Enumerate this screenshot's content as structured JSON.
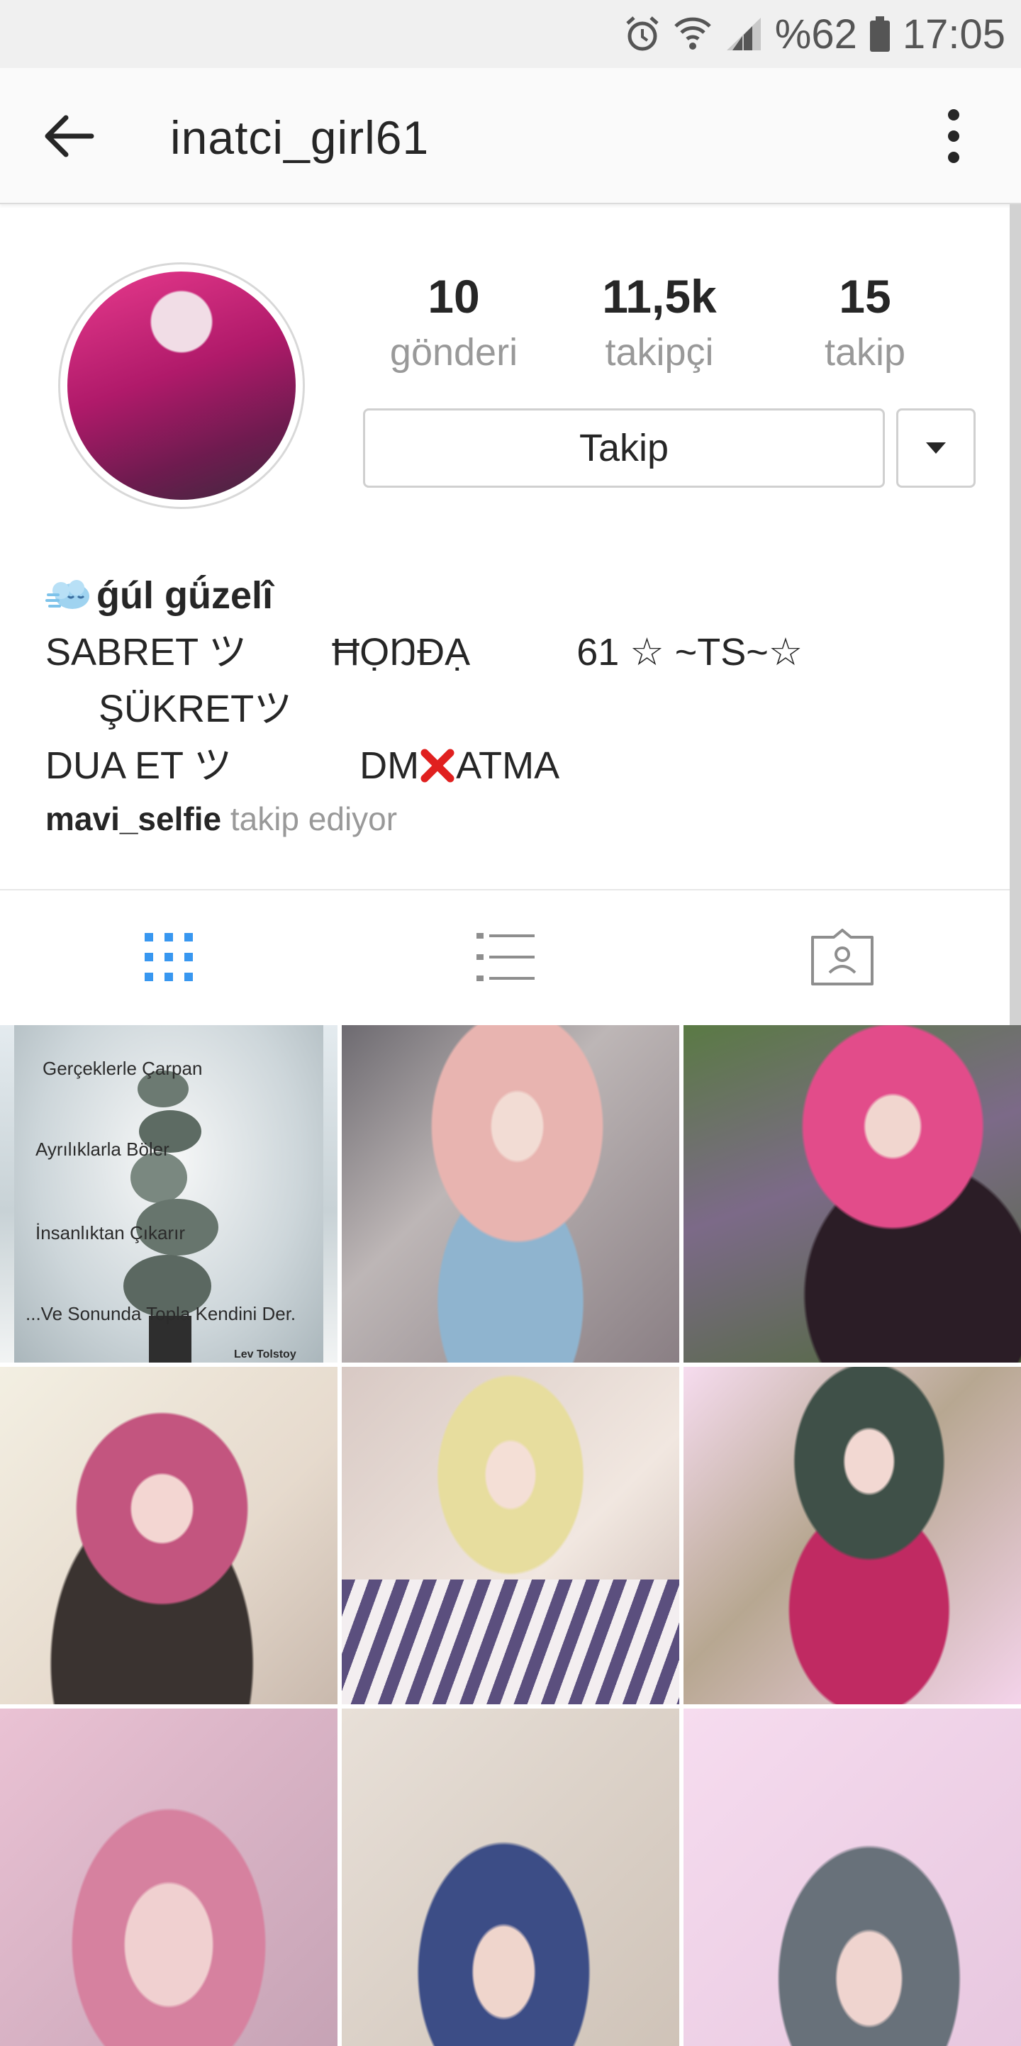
{
  "status_bar": {
    "battery": "%62",
    "time": "17:05",
    "icons": [
      "alarm-icon",
      "wifi-icon",
      "signal-icon",
      "battery-icon"
    ]
  },
  "app_bar": {
    "title": "inatci_girl61",
    "back_icon": "arrow-left-icon",
    "menu_icon": "more-vertical-icon"
  },
  "profile": {
    "posts_count": "10",
    "posts_label": "gönderi",
    "followers_count": "11,5k",
    "followers_label": "takipçi",
    "following_count": "15",
    "following_label": "takip",
    "follow_button": "Takip",
    "dropdown_icon": "caret-down-icon"
  },
  "bio": {
    "name": "ǵúl gǘzelî",
    "line1_a": "SABRET ツ",
    "line1_b": "ĦỌŊĐẠ",
    "line1_c": "61 ☆ ~TS~☆",
    "line2": "ŞÜKRETツ",
    "line3_a": "DUA ET ツ",
    "line3_b_pre": "DM",
    "line3_b_post": "ATMA",
    "followed_user": "mavi_selfie",
    "followed_text": "takip ediyor"
  },
  "tabs": [
    {
      "icon": "grid-icon",
      "active": true
    },
    {
      "icon": "list-icon",
      "active": false
    },
    {
      "icon": "tagged-icon",
      "active": false
    }
  ],
  "grid": {
    "quote": {
      "line1": "Gerçeklerle Çarpan",
      "line2": "Ayrılıklarla Böler",
      "line3": "İnsanlıktan Çıkarır",
      "line4": "...Ve Sonunda Topla Kendini Der.",
      "author": "Lev Tolstoy"
    }
  },
  "colors": {
    "active_tab": "#3897f0",
    "inactive_icon": "#8e8e8e",
    "text": "#262626",
    "muted": "#999999"
  }
}
